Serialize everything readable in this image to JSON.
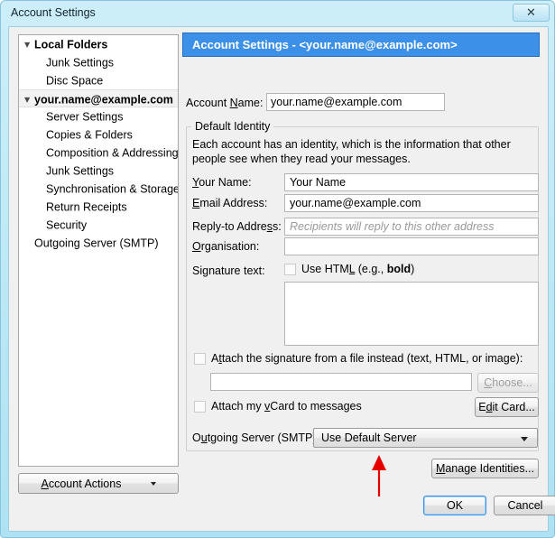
{
  "window": {
    "title": "Account Settings",
    "close_icon": "close-icon",
    "close_glyph": "✕",
    "frame_color": "#bfe9f6",
    "accent_color": "#3d90e8"
  },
  "sidebar": {
    "items": [
      {
        "label": "Local Folders",
        "level": "root",
        "bold": true,
        "expanded": true,
        "selected": false
      },
      {
        "label": "Junk Settings",
        "level": "child",
        "bold": false,
        "expanded": null,
        "selected": false
      },
      {
        "label": "Disc Space",
        "level": "child",
        "bold": false,
        "expanded": null,
        "selected": false
      },
      {
        "label": "your.name@example.com",
        "level": "root",
        "bold": false,
        "expanded": true,
        "selected": true
      },
      {
        "label": "Server Settings",
        "level": "child",
        "bold": false,
        "expanded": null,
        "selected": false
      },
      {
        "label": "Copies & Folders",
        "level": "child",
        "bold": false,
        "expanded": null,
        "selected": false
      },
      {
        "label": "Composition & Addressing",
        "level": "child",
        "bold": false,
        "expanded": null,
        "selected": false
      },
      {
        "label": "Junk Settings",
        "level": "child",
        "bold": false,
        "expanded": null,
        "selected": false
      },
      {
        "label": "Synchronisation & Storage",
        "level": "child",
        "bold": false,
        "expanded": null,
        "selected": false
      },
      {
        "label": "Return Receipts",
        "level": "child",
        "bold": false,
        "expanded": null,
        "selected": false
      },
      {
        "label": "Security",
        "level": "child",
        "bold": false,
        "expanded": null,
        "selected": false
      },
      {
        "label": "Outgoing Server (SMTP)",
        "level": "root-plain",
        "bold": false,
        "expanded": null,
        "selected": false
      }
    ],
    "account_actions_label": "Account Actions",
    "account_actions_accel": "A"
  },
  "main": {
    "header": "Account Settings - <your.name@example.com>",
    "account_name_label": "Account Name:",
    "account_name_accel": "N",
    "account_name_value": "your.name@example.com",
    "group": {
      "title": "Default Identity",
      "description": "Each account has an identity, which is the information that other people see when they read your messages.",
      "fields": [
        {
          "label": "Your Name:",
          "accel": "Y",
          "value": "Your Name",
          "placeholder": ""
        },
        {
          "label": "Email Address:",
          "accel": "E",
          "value": "your.name@example.com",
          "placeholder": ""
        },
        {
          "label": "Reply-to Address:",
          "accel": "s",
          "value": "",
          "placeholder": "Recipients will reply to this other address"
        },
        {
          "label": "Organisation:",
          "accel": "O",
          "value": "",
          "placeholder": ""
        }
      ],
      "signature_label": "Signature text:",
      "use_html_label": "Use HTML (e.g., <b>bold</b>)",
      "use_html_accel": "L",
      "use_html_checked": false,
      "signature_value": "",
      "attach_file_label": "Attach the signature from a file instead (text, HTML, or image):",
      "attach_file_accel": "t",
      "attach_file_checked": false,
      "attach_file_value": "",
      "choose_label": "Choose...",
      "choose_accel": "C",
      "choose_disabled": true,
      "vcard_label": "Attach my vCard to messages",
      "vcard_accel": "v",
      "vcard_checked": false,
      "edit_card_label": "Edit Card...",
      "edit_card_accel": "d",
      "smtp_label": "Outgoing Server (SMTP):",
      "smtp_accel": "u",
      "smtp_value": "Use Default Server"
    },
    "manage_identities_label": "Manage Identities...",
    "manage_identities_accel": "M"
  },
  "annotation": {
    "type": "arrow",
    "color": "#e60000",
    "points_to": "outgoing-server-smtp-dropdown"
  },
  "footer": {
    "ok_label": "OK",
    "cancel_label": "Cancel",
    "default_button": "OK"
  }
}
